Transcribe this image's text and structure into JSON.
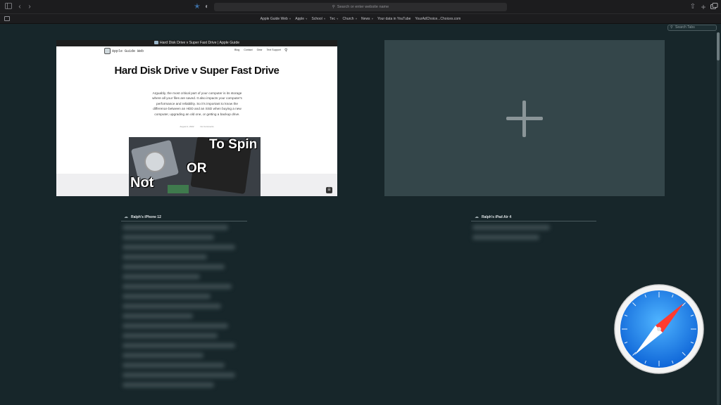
{
  "toolbar": {
    "address_placeholder": "Search or enter website name"
  },
  "bookmarks": [
    {
      "label": "Apple Guide Web",
      "folder": true
    },
    {
      "label": "Apple",
      "folder": true
    },
    {
      "label": "School",
      "folder": true
    },
    {
      "label": "Tec",
      "folder": true
    },
    {
      "label": "Church",
      "folder": true
    },
    {
      "label": "News",
      "folder": true
    },
    {
      "label": "Your data in YouTube",
      "folder": false
    },
    {
      "label": "YourAdChoice...Choices.com",
      "folder": false
    }
  ],
  "search_tabs": {
    "placeholder": "Search Tabs"
  },
  "tab": {
    "title": "Hard Disk Drive v Super Fast Drive | Apple Guide",
    "site_name": "Apple Guide Web",
    "nav": [
      "Blog",
      "Contact",
      "Gear",
      "Text Support"
    ],
    "article_title": "Hard Disk Drive v Super Fast Drive",
    "article_body": "Arguably, the most critical part of your computer is its storage where all your files are saved. It also impacts your computer's performance and reliability. So it's important to know the difference between an HDD and an SSD when buying a new computer, upgrading an old one, or getting a backup drive.",
    "meta_date": "August 2, 2022",
    "meta_comments": "No Comments",
    "hero_text": {
      "line1": "To Spin",
      "line2": "OR",
      "line3": "Not"
    }
  },
  "devices": [
    {
      "name": "Ralph's iPhone 12"
    },
    {
      "name": "Ralph's iPad Air 4"
    }
  ],
  "colors": {
    "background": "#17262a",
    "new_tab_card": "#34464a",
    "toolbar": "#1c1c1e"
  }
}
